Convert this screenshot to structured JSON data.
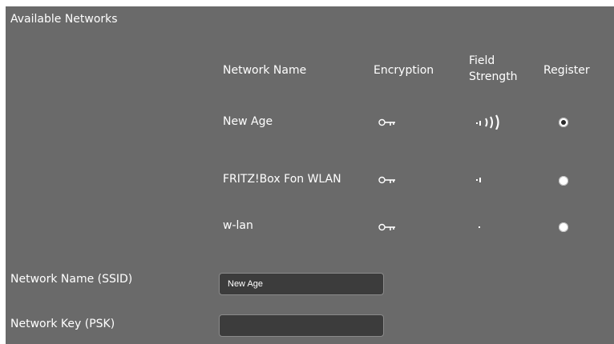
{
  "section": {
    "title": "Available Networks"
  },
  "table": {
    "headers": {
      "network_name": "Network Name",
      "encryption": "Encryption",
      "field_strength_line1": "Field",
      "field_strength_line2": "Strength",
      "register": "Register"
    },
    "rows": [
      {
        "name": "New Age",
        "encryption_icon": "key-icon",
        "signal_bars": 4,
        "registered": true
      },
      {
        "name": "FRITZ!Box Fon WLAN",
        "encryption_icon": "key-icon",
        "signal_bars": 2,
        "registered": false
      },
      {
        "name": "w-lan",
        "encryption_icon": "key-icon",
        "signal_bars": 1,
        "registered": false
      }
    ]
  },
  "form": {
    "ssid_label": "Network Name (SSID)",
    "ssid_value": "New Age",
    "psk_label": "Network Key (PSK)",
    "psk_value": ""
  },
  "colors": {
    "panel_background": "#6a6a6a",
    "field_background": "#3c3c3c",
    "text": "#ffffff"
  }
}
